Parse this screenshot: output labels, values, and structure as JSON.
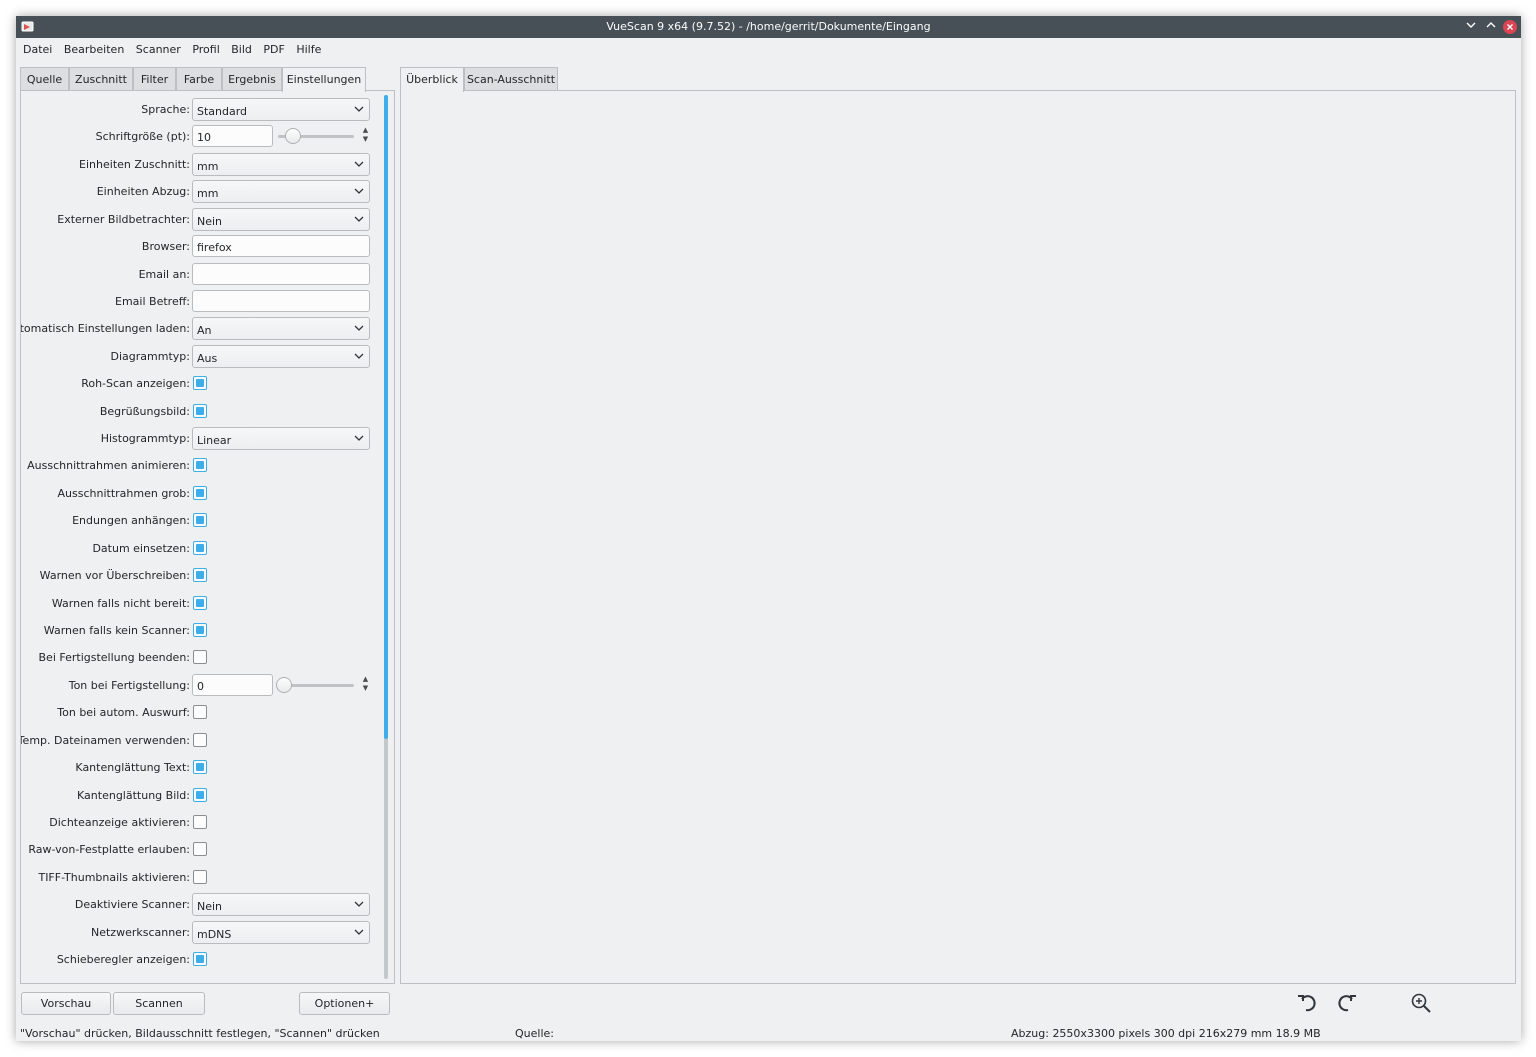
{
  "window": {
    "title": "VueScan 9 x64 (9.7.52) - /home/gerrit/Dokumente/Eingang"
  },
  "menu": [
    "Datei",
    "Bearbeiten",
    "Scanner",
    "Profil",
    "Bild",
    "PDF",
    "Hilfe"
  ],
  "left_tabs": [
    "Quelle",
    "Zuschnitt",
    "Filter",
    "Farbe",
    "Ergebnis",
    "Einstellungen"
  ],
  "active_left_tab": "Einstellungen",
  "right_tabs": [
    "Überblick",
    "Scan-Ausschnitt"
  ],
  "active_right_tab": "Überblick",
  "settings": [
    {
      "label": "Sprache:",
      "type": "combo",
      "value": "Standard"
    },
    {
      "label": "Schriftgröße (pt):",
      "type": "spin",
      "value": "10",
      "slider_fraction": 0.2
    },
    {
      "label": "Einheiten Zuschnitt:",
      "type": "combo",
      "value": "mm"
    },
    {
      "label": "Einheiten Abzug:",
      "type": "combo",
      "value": "mm"
    },
    {
      "label": "Externer Bildbetrachter:",
      "type": "combo",
      "value": "Nein"
    },
    {
      "label": "Browser:",
      "type": "text",
      "value": "firefox"
    },
    {
      "label": "Email an:",
      "type": "text",
      "value": ""
    },
    {
      "label": "Email Betreff:",
      "type": "text",
      "value": ""
    },
    {
      "label": "Automatisch Einstellungen laden:",
      "type": "combo",
      "value": "An"
    },
    {
      "label": "Diagrammtyp:",
      "type": "combo",
      "value": "Aus"
    },
    {
      "label": "Roh-Scan anzeigen:",
      "type": "check",
      "checked": true
    },
    {
      "label": "Begrüßungsbild:",
      "type": "check",
      "checked": true
    },
    {
      "label": "Histogrammtyp:",
      "type": "combo",
      "value": "Linear"
    },
    {
      "label": "Ausschnittrahmen animieren:",
      "type": "check",
      "checked": true
    },
    {
      "label": "Ausschnittrahmen grob:",
      "type": "check",
      "checked": true
    },
    {
      "label": "Endungen anhängen:",
      "type": "check",
      "checked": true
    },
    {
      "label": "Datum einsetzen:",
      "type": "check",
      "checked": true
    },
    {
      "label": "Warnen vor Überschreiben:",
      "type": "check",
      "checked": true
    },
    {
      "label": "Warnen falls nicht bereit:",
      "type": "check",
      "checked": true
    },
    {
      "label": "Warnen falls kein Scanner:",
      "type": "check",
      "checked": true
    },
    {
      "label": "Bei Fertigstellung beenden:",
      "type": "check",
      "checked": false
    },
    {
      "label": "Ton bei Fertigstellung:",
      "type": "spin",
      "value": "0",
      "slider_fraction": 0.0
    },
    {
      "label": "Ton bei autom. Auswurf:",
      "type": "check",
      "checked": false
    },
    {
      "label": "Temp. Dateinamen verwenden:",
      "type": "check",
      "checked": false
    },
    {
      "label": "Kantenglättung Text:",
      "type": "check",
      "checked": true
    },
    {
      "label": "Kantenglättung Bild:",
      "type": "check",
      "checked": true
    },
    {
      "label": "Dichteanzeige aktivieren:",
      "type": "check",
      "checked": false
    },
    {
      "label": "Raw-von-Festplatte erlauben:",
      "type": "check",
      "checked": false
    },
    {
      "label": "TIFF-Thumbnails aktivieren:",
      "type": "check",
      "checked": false
    },
    {
      "label": "Deaktiviere Scanner:",
      "type": "combo",
      "value": "Nein"
    },
    {
      "label": "Netzwerkscanner:",
      "type": "combo",
      "value": "mDNS"
    },
    {
      "label": "Schieberegler anzeigen:",
      "type": "check",
      "checked": true
    }
  ],
  "buttons": {
    "preview": "Vorschau",
    "scan": "Scannen",
    "options": "Optionen+"
  },
  "toolbar_icons": [
    "rotate-left-icon",
    "rotate-right-icon",
    "zoom-in-icon"
  ],
  "status": {
    "hint": "\"Vorschau\" drücken, Bildausschnitt festlegen, \"Scannen\" drücken",
    "source": "Quelle:",
    "output": "Abzug: 2550x3300 pixels 300 dpi 216x279 mm 18.9 MB"
  },
  "colors": {
    "titlebar": "#475057",
    "accent": "#3daee9",
    "close": "#da4453",
    "background": "#eff0f1"
  }
}
